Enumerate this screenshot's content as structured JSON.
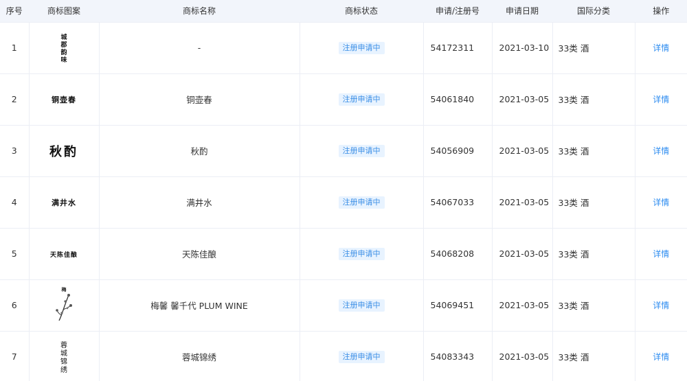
{
  "table": {
    "headers": [
      "序号",
      "商标图案",
      "商标名称",
      "商标状态",
      "申请/注册号",
      "申请日期",
      "国际分类",
      "操作"
    ],
    "rows": [
      {
        "index": "1",
        "logo_text": "城郡韵味",
        "name": "-",
        "status": "注册申请中",
        "reg_no": "54172311",
        "date": "2021-03-10",
        "class": "33类 酒",
        "action": "详情"
      },
      {
        "index": "2",
        "logo_text": "铜壶春",
        "name": "铜壶春",
        "status": "注册申请中",
        "reg_no": "54061840",
        "date": "2021-03-05",
        "class": "33类 酒",
        "action": "详情"
      },
      {
        "index": "3",
        "logo_text": "秋酌",
        "name": "秋酌",
        "status": "注册申请中",
        "reg_no": "54056909",
        "date": "2021-03-05",
        "class": "33类 酒",
        "action": "详情"
      },
      {
        "index": "4",
        "logo_text": "满井水",
        "name": "满井水",
        "status": "注册申请中",
        "reg_no": "54067033",
        "date": "2021-03-05",
        "class": "33类 酒",
        "action": "详情"
      },
      {
        "index": "5",
        "logo_text": "天陈佳酿",
        "name": "天陈佳酿",
        "status": "注册申请中",
        "reg_no": "54068208",
        "date": "2021-03-05",
        "class": "33类 酒",
        "action": "详情"
      },
      {
        "index": "6",
        "logo_text": "梅馨",
        "name": "梅馨 馨千代 PLUM WINE",
        "status": "注册申请中",
        "reg_no": "54069451",
        "date": "2021-03-05",
        "class": "33类 酒",
        "action": "详情"
      },
      {
        "index": "7",
        "logo_text": "蓉城锦绣",
        "name": "蓉城锦绣",
        "status": "注册申请中",
        "reg_no": "54083343",
        "date": "2021-03-05",
        "class": "33类 酒",
        "action": "详情"
      }
    ]
  }
}
